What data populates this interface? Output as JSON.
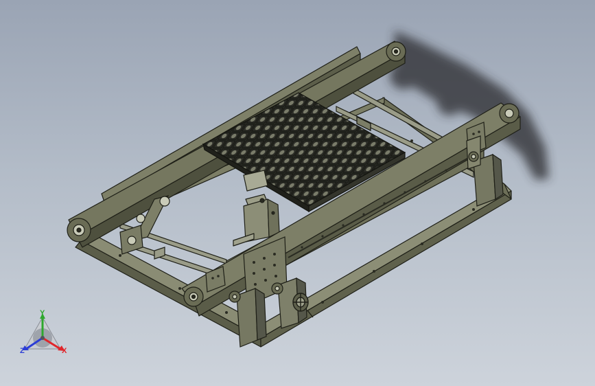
{
  "viewport": {
    "background_top": "#9aa4b4",
    "background_bottom": "#cdd3db",
    "model_color": "#6d6f58",
    "model_edge_color": "#1e1f17"
  },
  "triad": {
    "x_label": "X",
    "y_label": "Y",
    "z_label": "Z",
    "x_color": "#e0262b",
    "y_color": "#2ea82e",
    "z_color": "#2c3dd6"
  }
}
